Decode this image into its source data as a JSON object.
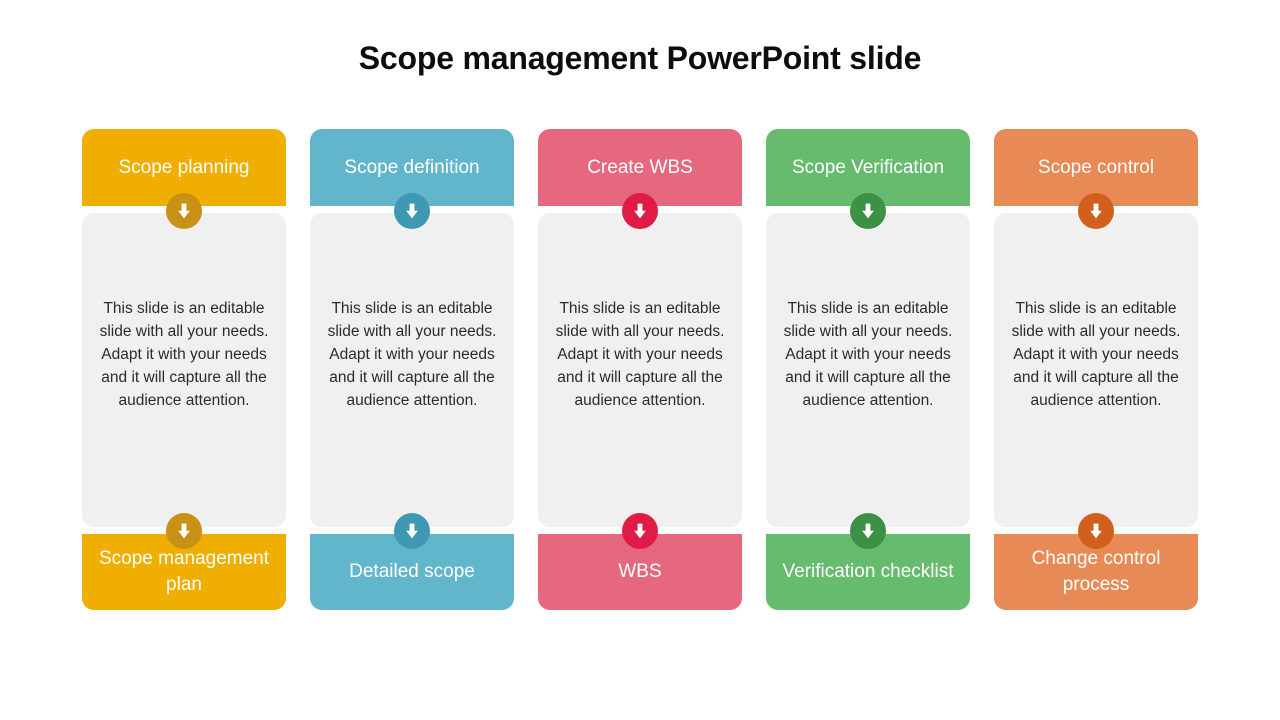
{
  "slide": {
    "title": "Scope management PowerPoint slide",
    "background": "#ffffff",
    "body_panel_color": "#f0f0f0",
    "arrow_icon_name": "down-arrow-icon"
  },
  "columns": [
    {
      "header": "Scope planning",
      "body": "This slide is an editable slide with all your needs. Adapt it with your needs and it will capture all the audience attention.",
      "footer": "Scope management plan",
      "color": "#efae00",
      "badge_color": "#c99115"
    },
    {
      "header": "Scope definition",
      "body": "This slide is an editable slide with all your needs. Adapt it with your needs and it will capture all the audience attention.",
      "footer": "Detailed scope",
      "color": "#62b6cb",
      "badge_color": "#3f99b4"
    },
    {
      "header": "Create WBS",
      "body": "This slide is an editable slide with all your needs. Adapt it with your needs and it will capture all the audience attention.",
      "footer": "WBS",
      "color": "#e6687e",
      "badge_color": "#e01b45"
    },
    {
      "header": "Scope Verification",
      "body": "This slide is an editable slide with all your needs. Adapt it with your needs and it will capture all the audience attention.",
      "footer": "Verification checklist",
      "color": "#67bb6e",
      "badge_color": "#3d9147"
    },
    {
      "header": "Scope control",
      "body": "This slide is an editable slide with all your needs. Adapt it with your needs and it will capture all the audience attention.",
      "footer": "Change control process",
      "color": "#e88a55",
      "badge_color": "#d2601c"
    }
  ]
}
